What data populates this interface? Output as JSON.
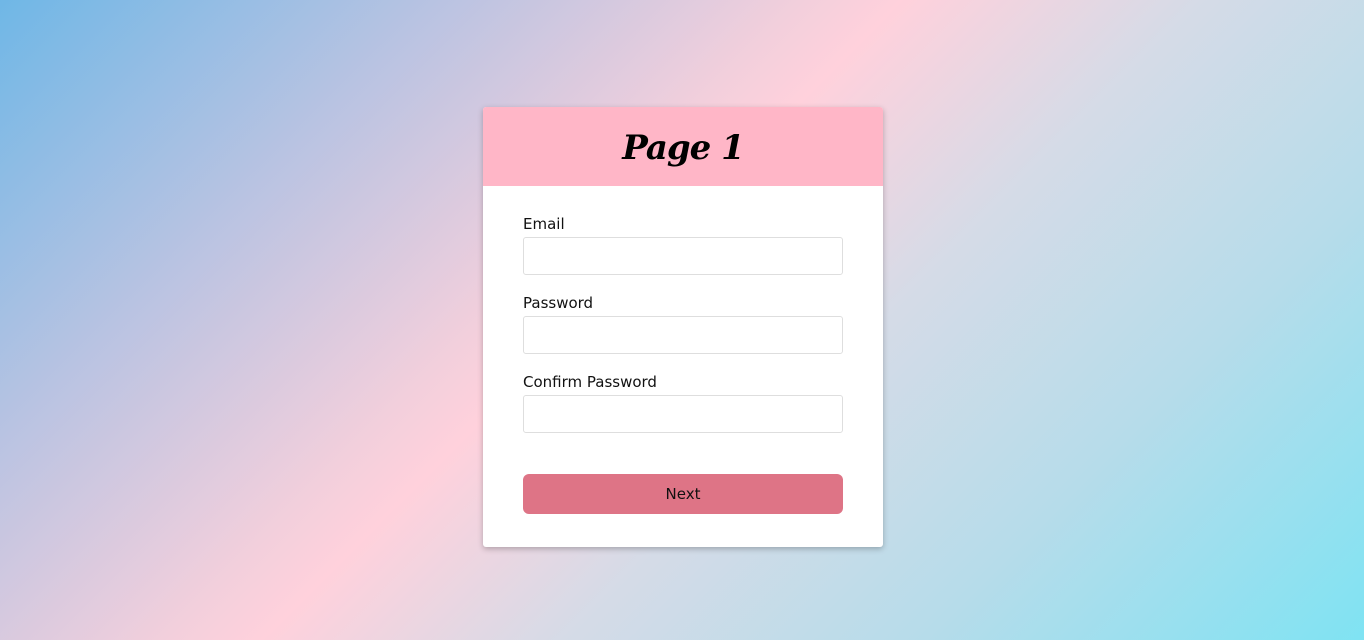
{
  "header": {
    "title": "Page 1"
  },
  "form": {
    "email": {
      "label": "Email",
      "value": "",
      "placeholder": ""
    },
    "password": {
      "label": "Password",
      "value": "",
      "placeholder": ""
    },
    "confirm_password": {
      "label": "Confirm Password",
      "value": "",
      "placeholder": ""
    },
    "next_label": "Next"
  },
  "colors": {
    "header_bg": "#ffb6c7",
    "button_bg": "#de7486",
    "card_bg": "#ffffff"
  }
}
